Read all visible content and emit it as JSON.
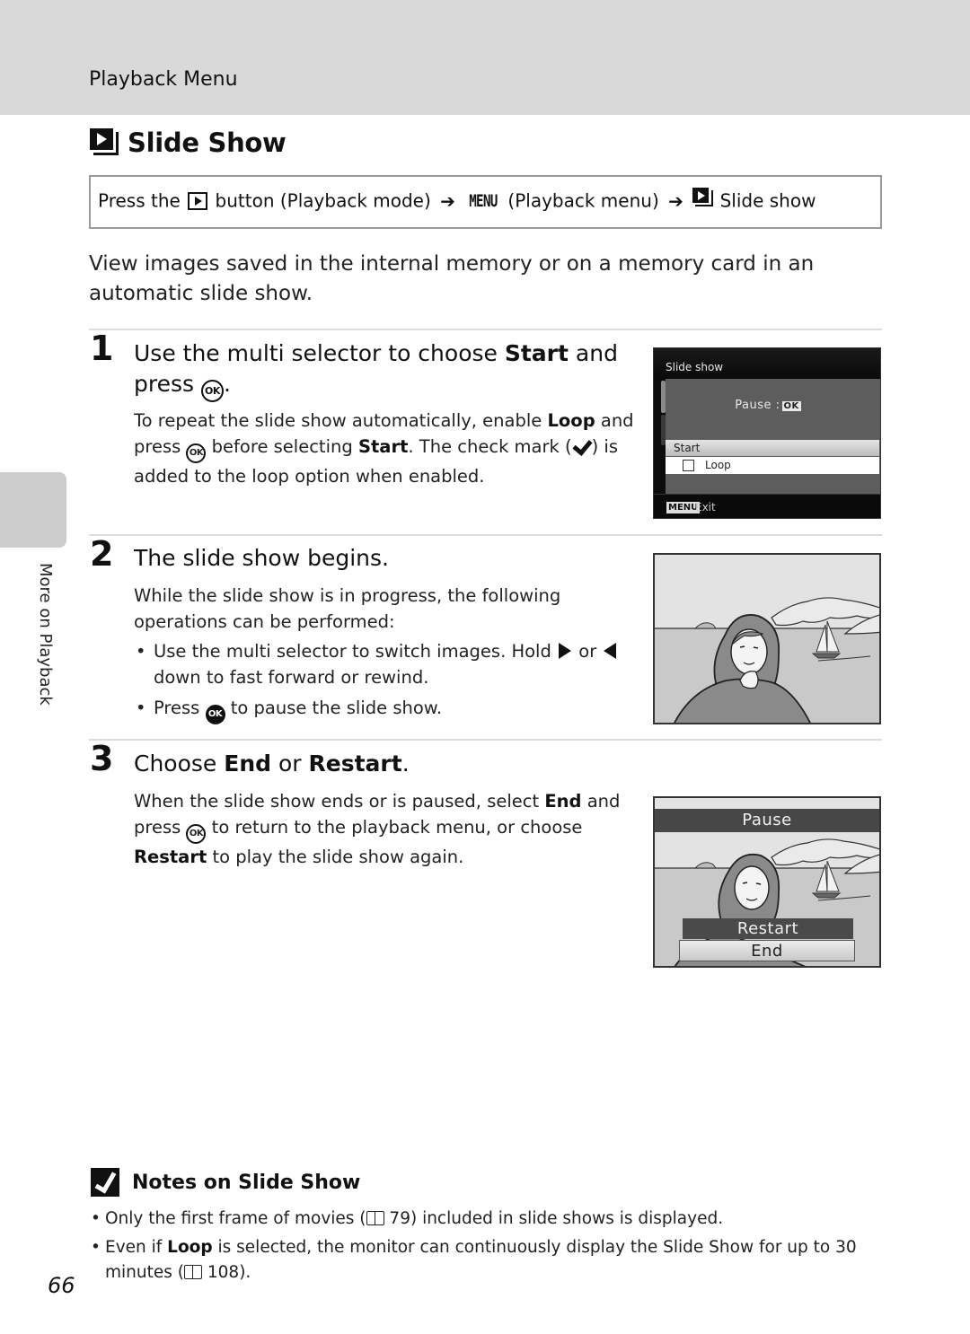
{
  "header": {
    "section_label": "Playback Menu"
  },
  "page": {
    "title": "Slide Show",
    "title_icon": "slideshow-icon",
    "page_number": "66",
    "side_tab_label": "More on Playback"
  },
  "navigation": {
    "press_the": "Press the",
    "play_button_icon": "playback-button-icon",
    "button_text": "button (Playback mode)",
    "arrow1": "➔",
    "menu_key": "MENU",
    "menu_text": "(Playback menu)",
    "arrow2": "➔",
    "slideshow_icon": "slideshow-icon",
    "final_item": "Slide show"
  },
  "intro": "View images saved in the internal memory or on a memory card in an automatic slide show.",
  "steps": [
    {
      "number": "1",
      "heading_pre": "Use the multi selector to choose ",
      "heading_bold": "Start",
      "heading_mid": " and press ",
      "heading_ok": "OK",
      "heading_post": ".",
      "body_1": "To repeat the slide show automatically, enable ",
      "body_bold_loop": "Loop",
      "body_2": " and press ",
      "body_ok": "OK",
      "body_3": " before selecting ",
      "body_bold_start": "Start",
      "body_4": ". The check mark (",
      "body_5": ") is added to the loop option when enabled.",
      "screen": {
        "title": "Slide show",
        "pause_hint": "Pause :",
        "pause_ok": "OK",
        "option_start": "Start",
        "option_loop": "Loop",
        "loop_checked": false,
        "menu_key": "MENU",
        "exit_label": "Exit"
      }
    },
    {
      "number": "2",
      "heading": "The slide show begins.",
      "body": "While the slide show is in progress, the following operations can be performed:",
      "bullet_1_pre": "Use the multi selector to switch images. Hold ",
      "bullet_1_mid": " or ",
      "bullet_1_post": " down to fast forward or rewind.",
      "bullet_2_pre": "Press ",
      "bullet_2_ok": "OK",
      "bullet_2_post": " to pause the slide show."
    },
    {
      "number": "3",
      "heading_pre": "Choose ",
      "heading_bold_end": "End",
      "heading_mid": " or ",
      "heading_bold_restart": "Restart",
      "heading_post": ".",
      "body_1": "When the slide show ends or is paused, select ",
      "body_bold_end": "End",
      "body_2": " and press ",
      "body_ok": "OK",
      "body_3": " to return to the playback menu, or choose ",
      "body_bold_restart": "Restart",
      "body_4": " to play the slide show again.",
      "screen": {
        "pause_label": "Pause",
        "option_restart": "Restart",
        "option_end": "End"
      }
    }
  ],
  "notes": {
    "title": "Notes on Slide Show",
    "items": [
      {
        "pre": "Only the first frame of movies (",
        "ref": "79",
        "post": ") included in slide shows is displayed."
      },
      {
        "pre": "Even if ",
        "bold": "Loop",
        "mid": " is selected, the monitor can continuously display the Slide Show for up to 30 minutes (",
        "ref": "108",
        "post": ")."
      }
    ]
  }
}
